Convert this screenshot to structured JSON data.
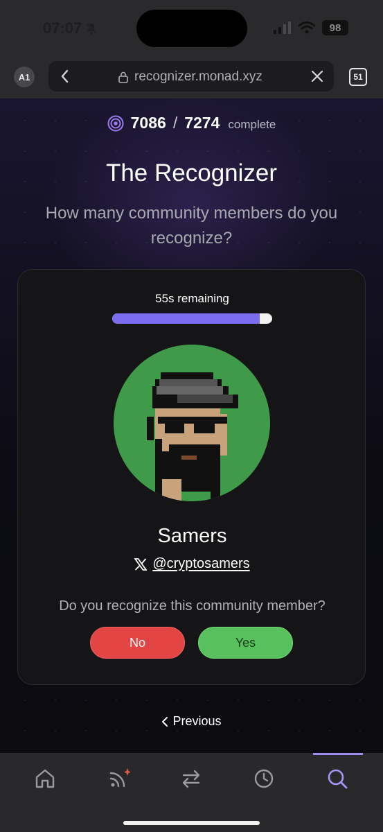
{
  "status_bar": {
    "time": "07:07",
    "battery": "98",
    "icons": [
      "bell-slash-icon",
      "cellular-signal-icon",
      "wifi-icon",
      "battery-icon"
    ]
  },
  "browser": {
    "profile_badge": "A1",
    "url": "recognizer.monad.xyz",
    "tab_count": "51",
    "icons": [
      "back-chevron-icon",
      "lock-icon",
      "close-icon",
      "tabs-icon"
    ]
  },
  "progress": {
    "done": "7086",
    "separator": "/",
    "total": "7274",
    "label": "complete"
  },
  "header": {
    "title": "The Recognizer",
    "subtitle": "How many community members do you recognize?"
  },
  "card": {
    "timer_label": "55s remaining",
    "timer_fraction": 0.92,
    "name": "Samers",
    "handle": "@cryptosamers",
    "question": "Do you recognize this community member?",
    "no_label": "No",
    "yes_label": "Yes"
  },
  "nav": {
    "previous_label": "Previous"
  },
  "tabbar": {
    "tabs": [
      "home-icon",
      "feed-icon",
      "swap-icon",
      "history-icon",
      "search-icon"
    ],
    "active": "search-icon"
  },
  "colors": {
    "accent": "#7c6cf0",
    "no": "#e34444",
    "yes": "#59c05e",
    "avatar_bg": "#3f9a4a"
  }
}
